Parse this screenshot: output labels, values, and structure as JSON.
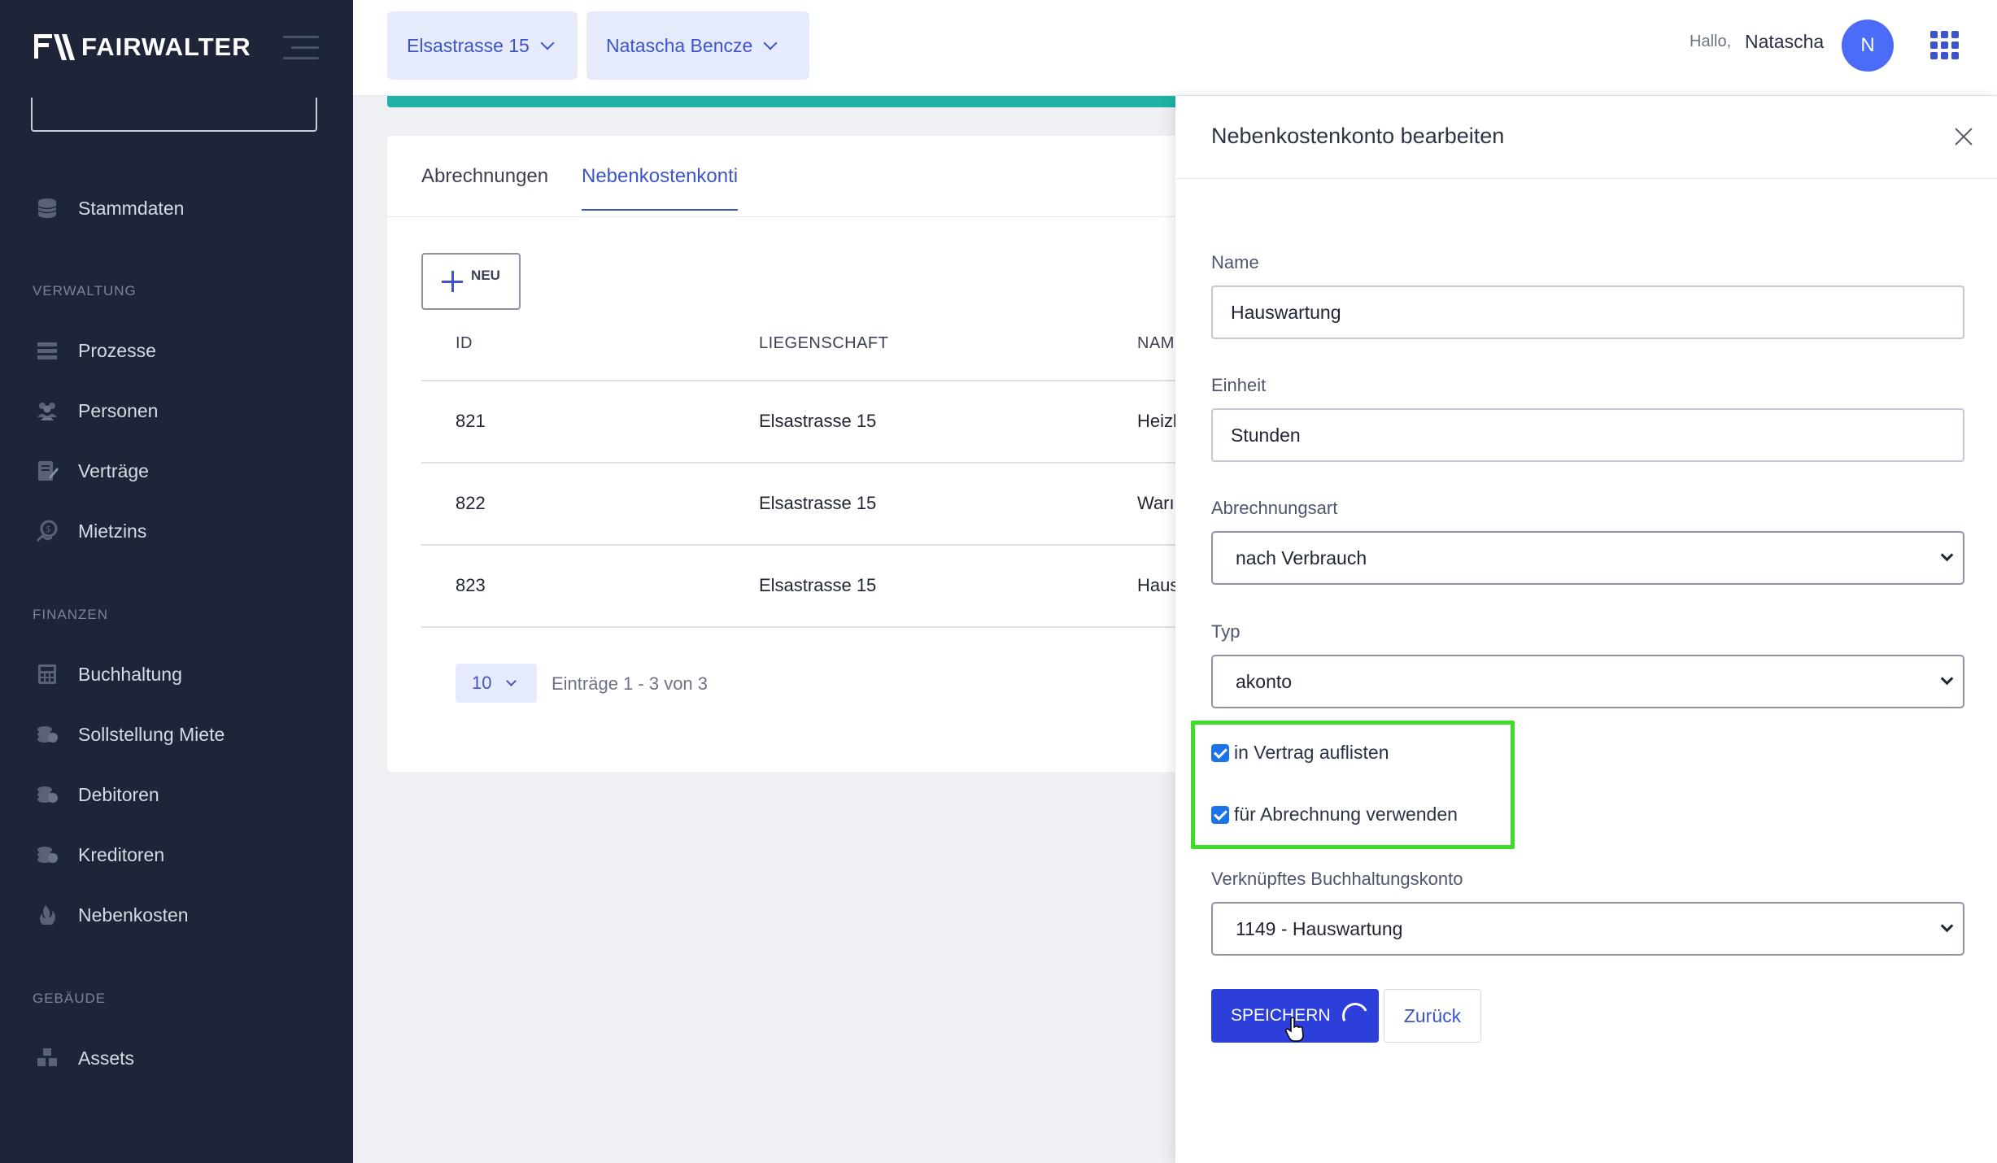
{
  "app": {
    "logo_text": "FAIRWALTER"
  },
  "sidebar": {
    "top_item": {
      "label": "Stammdaten",
      "icon": "database-icon"
    },
    "sections": [
      {
        "title": "VERWALTUNG",
        "items": [
          {
            "label": "Prozesse",
            "icon": "list-icon"
          },
          {
            "label": "Personen",
            "icon": "people-icon"
          },
          {
            "label": "Verträge",
            "icon": "contract-icon"
          },
          {
            "label": "Mietzins",
            "icon": "rent-icon"
          }
        ]
      },
      {
        "title": "FINANZEN",
        "items": [
          {
            "label": "Buchhaltung",
            "icon": "calculator-icon"
          },
          {
            "label": "Sollstellung Miete",
            "icon": "coins-icon"
          },
          {
            "label": "Debitoren",
            "icon": "coins-icon"
          },
          {
            "label": "Kreditoren",
            "icon": "coins-icon"
          },
          {
            "label": "Nebenkosten",
            "icon": "flame-icon"
          }
        ]
      },
      {
        "title": "GEBÄUDE",
        "items": [
          {
            "label": "Assets",
            "icon": "boxes-icon"
          }
        ]
      }
    ]
  },
  "topbar": {
    "property_selector": "Elsastrasse 15",
    "person_selector": "Natascha Bencze",
    "greeting": "Hallo,",
    "user_name": "Natascha",
    "avatar_initial": "N"
  },
  "main": {
    "tabs": [
      {
        "label": "Abrechnungen",
        "active": false
      },
      {
        "label": "Nebenkostenkonti",
        "active": true
      }
    ],
    "new_button_label": "NEU",
    "table": {
      "headers": [
        "ID",
        "LIEGENSCHAFT",
        "NAM"
      ],
      "rows": [
        [
          "821",
          "Elsastrasse 15",
          "Heizl"
        ],
        [
          "822",
          "Elsastrasse 15",
          "Warı"
        ],
        [
          "823",
          "Elsastrasse 15",
          "Haus"
        ]
      ]
    },
    "pagination": {
      "page_size": "10",
      "entries_info": "Einträge 1 - 3 von 3"
    }
  },
  "drawer": {
    "title": "Nebenkostenkonto bearbeiten",
    "fields": {
      "name": {
        "label": "Name",
        "value": "Hauswartung"
      },
      "einheit": {
        "label": "Einheit",
        "value": "Stunden"
      },
      "abrechnungsart": {
        "label": "Abrechnungsart",
        "value": "nach Verbrauch"
      },
      "typ": {
        "label": "Typ",
        "value": "akonto"
      },
      "konto": {
        "label": "Verknüpftes Buchhaltungskonto",
        "value": "1149 - Hauswartung"
      }
    },
    "checkboxes": [
      {
        "label": "in Vertrag auflisten",
        "checked": true
      },
      {
        "label": "für Abrechnung verwenden",
        "checked": true
      }
    ],
    "save_label": "SPEICHERN",
    "back_label": "Zurück"
  },
  "colors": {
    "sidebar_bg": "#1f2538",
    "accent": "#3d55c9",
    "primary_button": "#2c3fdb",
    "highlight": "#3fdc2c",
    "teal": "#20b2a5"
  }
}
